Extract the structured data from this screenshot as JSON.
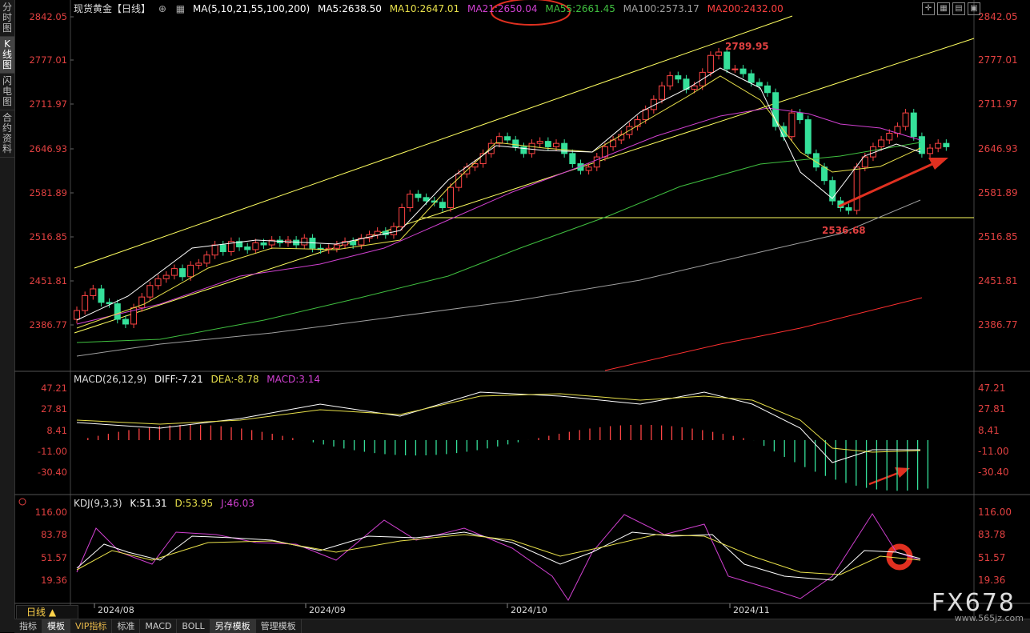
{
  "left_tabs": [
    "分时图",
    "K线图",
    "闪电图",
    "合约资料"
  ],
  "active_tab": 1,
  "main_header": {
    "symbol": "现货黄金【日线】",
    "symbol_icon": "circle-plus-icon",
    "ma_params": "MA(5,10,21,55,100,200)",
    "ma5": "MA5:2638.50",
    "ma10": "MA10:2647.01",
    "ma21": "MA21:2650.04",
    "ma55": "MA55:2661.45",
    "ma100": "MA100:2573.17",
    "ma200": "MA200:2432.00"
  },
  "price_axis": [
    "2842.05",
    "2777.01",
    "2711.97",
    "2646.93",
    "2581.89",
    "2516.85",
    "2451.81",
    "2386.77"
  ],
  "annotations": {
    "high": "2789.95",
    "low": "2536.68"
  },
  "macd_header": {
    "title": "MACD(26,12,9)",
    "diff": "DIFF:-7.21",
    "dea": "DEA:-8.78",
    "macd": "MACD:3.14"
  },
  "macd_axis": [
    "47.21",
    "27.81",
    "8.41",
    "-11.00",
    "-30.40"
  ],
  "kdj_header": {
    "title": "KDJ(9,3,3)",
    "k": "K:51.31",
    "d": "D:53.95",
    "j": "J:46.03"
  },
  "kdj_axis": [
    "116.00",
    "83.78",
    "51.57",
    "19.36"
  ],
  "dates": [
    "2024/08",
    "2024/09",
    "2024/10",
    "2024/11"
  ],
  "period_label": "日线",
  "bottom_tabs": [
    "指标",
    "模板",
    "VIP指标",
    "标准",
    "MACD",
    "BOLL",
    "另存模板",
    "管理模板"
  ],
  "watermark": "FX678",
  "watermark_sub": "www.565jz.com",
  "colors": {
    "up": "#ff4444",
    "down": "#35e09a",
    "ma5": "#ffffff",
    "ma10": "#e8e04a",
    "ma21": "#d040d0",
    "ma55": "#40c040",
    "ma100": "#a0a0a0",
    "ma200": "#ff3030",
    "channel": "#ffff60"
  }
}
